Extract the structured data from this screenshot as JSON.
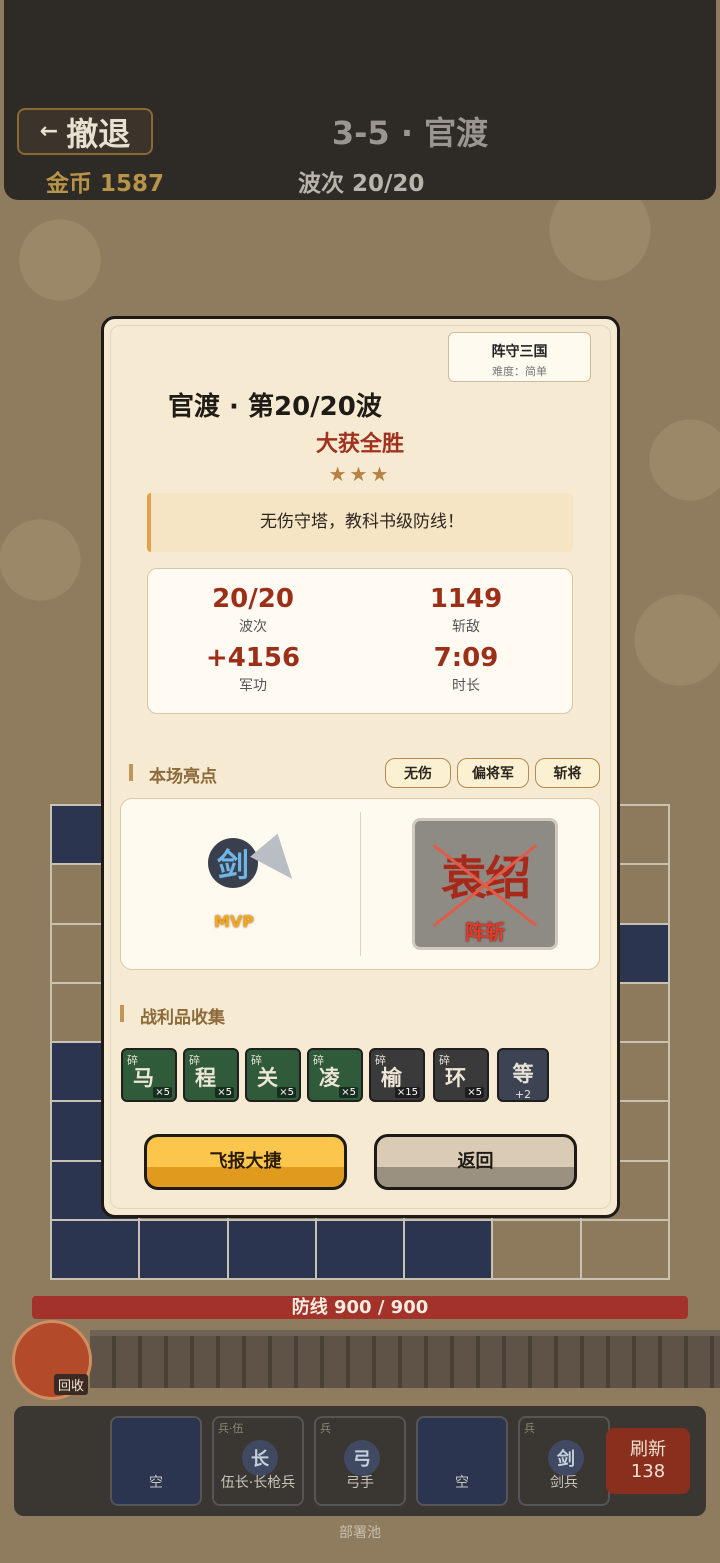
{
  "header": {
    "retreat_label": "撤退",
    "level_title": "3-5 · 官渡",
    "coins": "金币 1587",
    "wave": "波次 20/20"
  },
  "battlefield": {
    "defense_label": "防线 900 / 900",
    "recycle_label": "回收"
  },
  "deploy": {
    "slots": [
      {
        "tag": "",
        "glyph": "",
        "name": "空"
      },
      {
        "tag": "兵·伍",
        "glyph": "长",
        "name": "伍长·长枪兵"
      },
      {
        "tag": "兵",
        "glyph": "弓",
        "name": "弓手"
      },
      {
        "tag": "",
        "glyph": "",
        "name": "空"
      },
      {
        "tag": "兵",
        "glyph": "剑",
        "name": "剑兵"
      }
    ],
    "refresh_label": "刷新",
    "refresh_cost": "138",
    "pool_label": "部署池"
  },
  "dialog": {
    "brand": "阵守三国",
    "difficulty": "难度：简单",
    "title": "官渡 · 第20/20波",
    "status": "大获全胜",
    "stars": "★★★",
    "comment": "无伤守塔，教科书级防线！",
    "stats": [
      {
        "value": "20/20",
        "label": "波次"
      },
      {
        "value": "1149",
        "label": "斩敌"
      },
      {
        "value": "+4156",
        "label": "军功"
      },
      {
        "value": "7:09",
        "label": "时长"
      }
    ],
    "highlights_title": "本场亮点",
    "tags": [
      "无伤",
      "偏将军",
      "斩将"
    ],
    "mvp_unit": "剑",
    "mvp_label": "MVP",
    "killed_general": "袁绍",
    "killed_label": "阵斩",
    "loot_title": "战利品收集",
    "loot": [
      {
        "frag": "碎",
        "char": "马",
        "count": "×5"
      },
      {
        "frag": "碎",
        "char": "程",
        "count": "×5"
      },
      {
        "frag": "碎",
        "char": "关",
        "count": "×5"
      },
      {
        "frag": "碎",
        "char": "凌",
        "count": "×5"
      },
      {
        "frag": "碎",
        "char": "榆",
        "count": "×15"
      },
      {
        "frag": "碎",
        "char": "环",
        "count": "×5"
      }
    ],
    "loot_more": {
      "char": "等",
      "count": "+2"
    },
    "btn_primary": "飞报大捷",
    "btn_secondary": "返回"
  }
}
